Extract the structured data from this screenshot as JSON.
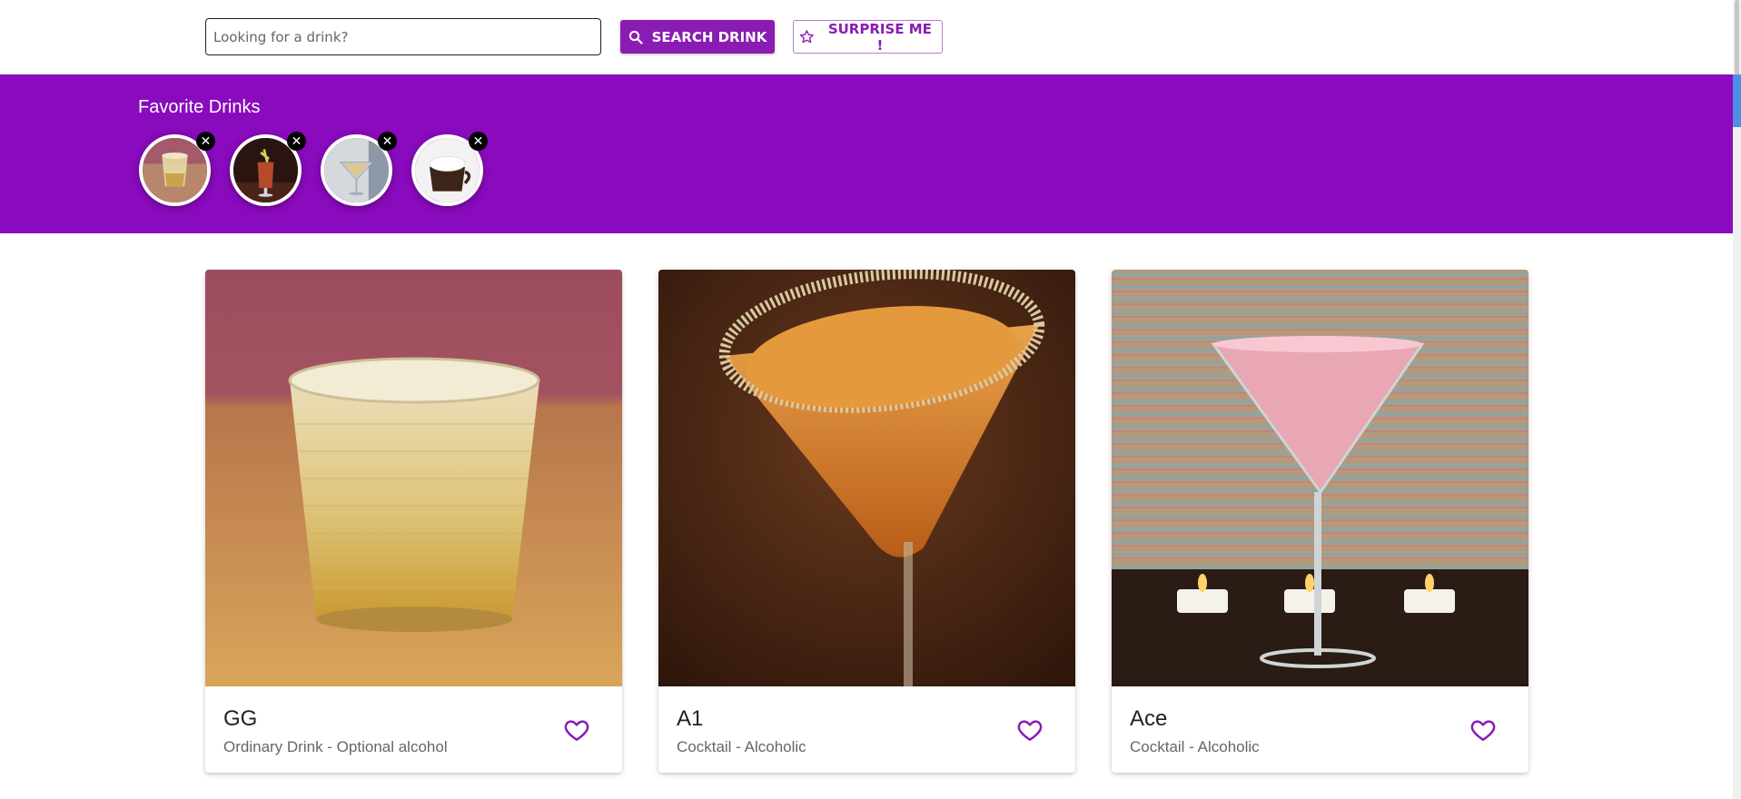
{
  "search": {
    "placeholder": "Looking for a drink?",
    "search_label": "SEARCH DRINK",
    "surprise_label": "SURPRISE ME !"
  },
  "favorites": {
    "title": "Favorite Drinks",
    "items": [
      {
        "image": "whiskey-rocks-thumb",
        "remove_glyph": "✕"
      },
      {
        "image": "iced-tea-garnish-thumb",
        "remove_glyph": "✕"
      },
      {
        "image": "martini-glass-thumb",
        "remove_glyph": "✕"
      },
      {
        "image": "hot-chocolate-thumb",
        "remove_glyph": "✕"
      }
    ]
  },
  "drinks": [
    {
      "name": "GG",
      "category": "Ordinary Drink - Optional alcohol",
      "image": "tumbler-on-ice-photo"
    },
    {
      "name": "A1",
      "category": "Cocktail - Alcoholic",
      "image": "orange-martini-photo"
    },
    {
      "name": "Ace",
      "category": "Cocktail - Alcoholic",
      "image": "pink-martini-candles-photo"
    }
  ],
  "icons": {
    "search": "search-icon",
    "star": "star-outline-icon",
    "heart": "heart-outline-icon",
    "close": "close-icon"
  },
  "colors": {
    "primary": "#8a1cb3",
    "favorites_band": "#8a0abd",
    "text_muted": "#666666"
  }
}
